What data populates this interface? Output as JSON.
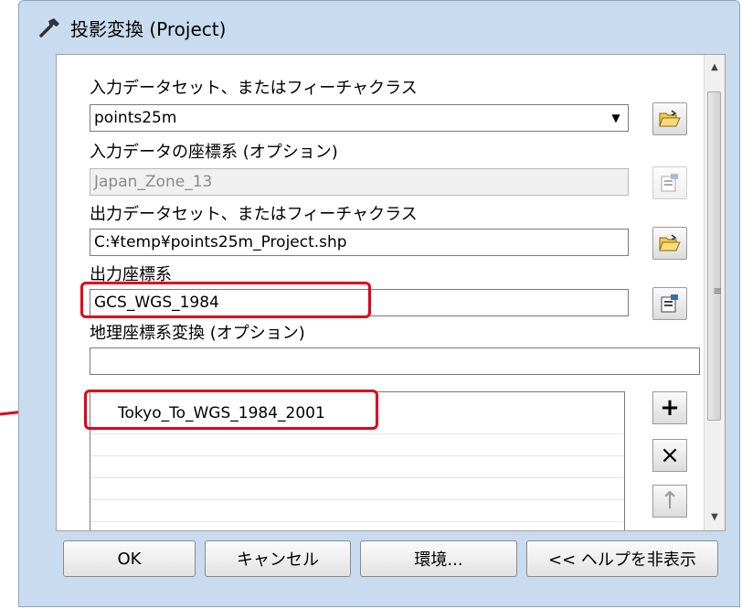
{
  "window": {
    "title": "投影変換 (Project)",
    "title_icon": "hammer-icon"
  },
  "form": {
    "input_dataset": {
      "label": "入力データセット、またはフィーチャクラス",
      "value": "points25m"
    },
    "input_coord": {
      "label": "入力データの座標系 (オプション)",
      "value": "Japan_Zone_13"
    },
    "output_dataset": {
      "label": "出力データセット、またはフィーチャクラス",
      "value": "C:¥temp¥points25m_Project.shp"
    },
    "output_coord": {
      "label": "出力座標系",
      "value": "GCS_WGS_1984"
    },
    "geo_transform": {
      "label": "地理座標系変換 (オプション)",
      "value": "",
      "list_items": [
        "Tokyo_To_WGS_1984_2001"
      ]
    }
  },
  "side_buttons": {
    "add": "+",
    "remove": "×",
    "up": "↑"
  },
  "buttons": {
    "ok": "OK",
    "cancel": "キャンセル",
    "environment": "環境...",
    "help": "<< ヘルプを非表示"
  },
  "colors": {
    "highlight": "#e0001b",
    "window_frame": "#c9dbee"
  }
}
